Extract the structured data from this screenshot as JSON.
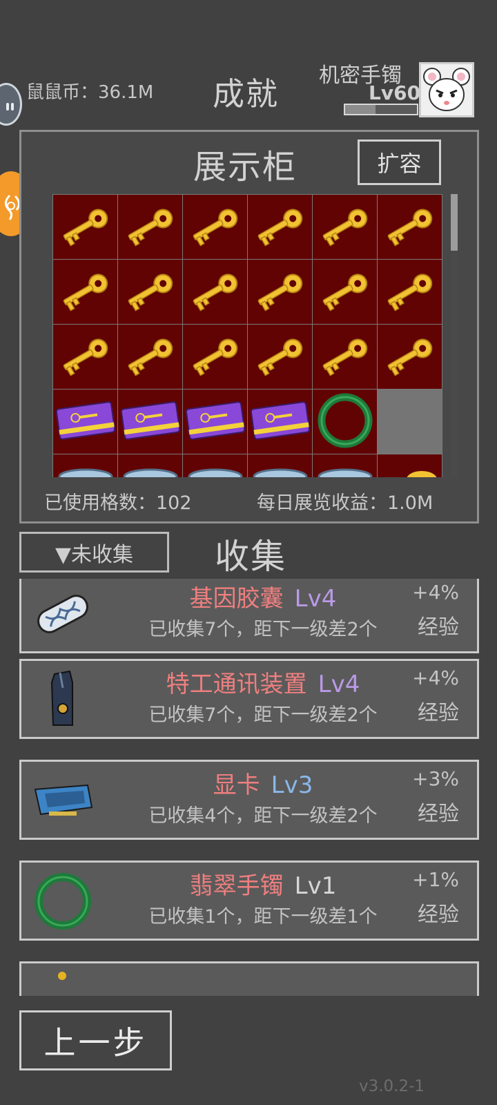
{
  "header": {
    "coins_label": "鼠鼠币：36.1M",
    "title": "成就",
    "equipped_item": "机密手镯",
    "level": "Lv60",
    "exp_progress": 0.42
  },
  "showcase": {
    "title": "展示柜",
    "expand_label": "扩容",
    "used_slots_label": "已使用格数：102",
    "daily_income_label": "每日展览收益：1.0M",
    "rows": [
      [
        "key",
        "key",
        "key",
        "key",
        "key",
        "key"
      ],
      [
        "key",
        "key",
        "key",
        "key",
        "key",
        "key"
      ],
      [
        "key",
        "key",
        "key",
        "key",
        "key",
        "key"
      ],
      [
        "card",
        "card",
        "card",
        "card",
        "bracelet",
        "empty"
      ],
      [
        "disc",
        "disc",
        "disc",
        "disc",
        "disc",
        "goldkey"
      ]
    ],
    "slot_colors": {
      "filled": "#620303",
      "empty": "#757575"
    }
  },
  "collect": {
    "filter_label": "▼未收集",
    "title": "收集",
    "items": [
      {
        "icon": "gene-capsule-icon",
        "name": "基因胶囊",
        "level": "Lv4",
        "level_color": "#b99ae6",
        "desc": "已收集7个，距下一级差2个",
        "bonus": "+4%",
        "bonus_label": "经验"
      },
      {
        "icon": "agent-communicator-icon",
        "name": "特工通讯装置",
        "level": "Lv4",
        "level_color": "#b99ae6",
        "desc": "已收集7个，距下一级差2个",
        "bonus": "+4%",
        "bonus_label": "经验"
      },
      {
        "icon": "graphics-card-icon",
        "name": "显卡",
        "level": "Lv3",
        "level_color": "#8ab8e8",
        "desc": "已收集4个，距下一级差2个",
        "bonus": "+3%",
        "bonus_label": "经验"
      },
      {
        "icon": "jade-bracelet-icon",
        "name": "翡翠手镯",
        "level": "Lv1",
        "level_color": "#d6d6d6",
        "desc": "已收集1个，距下一级差1个",
        "bonus": "+1%",
        "bonus_label": "经验"
      }
    ]
  },
  "footer": {
    "back_label": "上一步",
    "version": "v3.0.2-1"
  }
}
